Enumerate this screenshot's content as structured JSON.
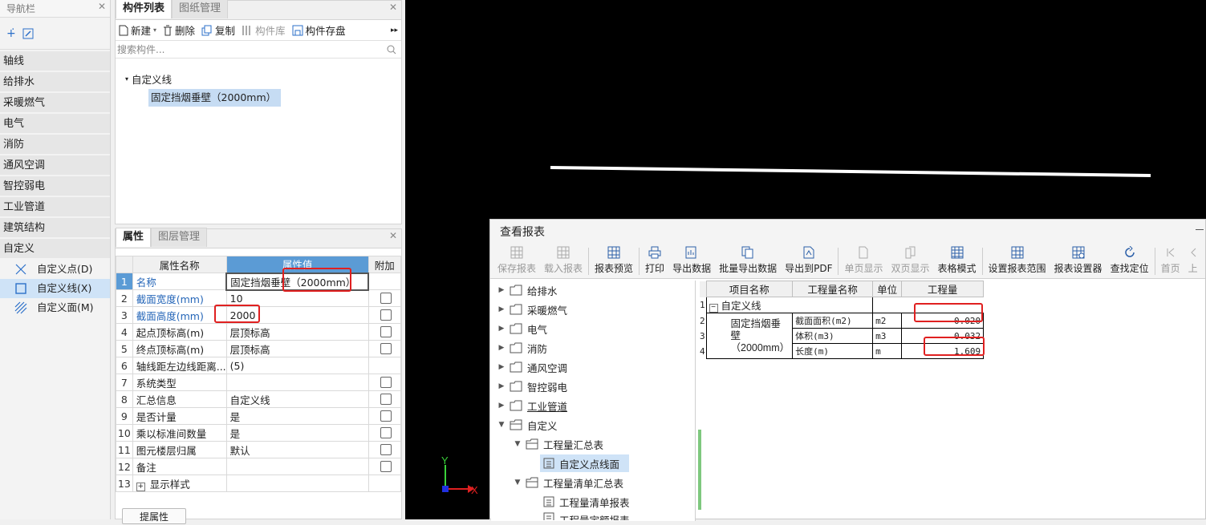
{
  "nav": {
    "title": "导航栏",
    "categories": [
      "轴线",
      "给排水",
      "采暖燃气",
      "电气",
      "消防",
      "通风空调",
      "智控弱电",
      "工业管道",
      "建筑结构",
      "自定义"
    ],
    "sub_items": [
      "自定义点(D)",
      "自定义线(X)",
      "自定义面(M)"
    ]
  },
  "component_panel": {
    "tabs": [
      "构件列表",
      "图纸管理"
    ],
    "toolbar": {
      "new": "新建",
      "delete": "删除",
      "copy": "复制",
      "library": "构件库",
      "save": "构件存盘"
    },
    "search_placeholder": "搜索构件...",
    "tree_root": "自定义线",
    "selected_item": "固定挡烟垂壁（2000mm）"
  },
  "properties_panel": {
    "tabs": [
      "属性",
      "图层管理"
    ],
    "headers": {
      "name": "属性名称",
      "value": "属性值",
      "extra": "附加"
    },
    "rows": [
      {
        "no": "1",
        "name": "名称",
        "value": "固定挡烟垂壁（2000mm）"
      },
      {
        "no": "2",
        "name": "截面宽度(mm)",
        "value": "10"
      },
      {
        "no": "3",
        "name": "截面高度(mm)",
        "value": "2000"
      },
      {
        "no": "4",
        "name": "起点顶标高(m)",
        "value": "层顶标高"
      },
      {
        "no": "5",
        "name": "终点顶标高(m)",
        "value": "层顶标高"
      },
      {
        "no": "6",
        "name": "轴线距左边线距离...",
        "value": "(5)"
      },
      {
        "no": "7",
        "name": "系统类型",
        "value": ""
      },
      {
        "no": "8",
        "name": "汇总信息",
        "value": "自定义线"
      },
      {
        "no": "9",
        "name": "是否计量",
        "value": "是"
      },
      {
        "no": "10",
        "name": "乘以标准间数量",
        "value": "是"
      },
      {
        "no": "11",
        "name": "图元楼层归属",
        "value": "默认"
      },
      {
        "no": "12",
        "name": "备注",
        "value": ""
      },
      {
        "no": "13",
        "name": "显示样式",
        "value": ""
      }
    ],
    "bottom_button": "提属性"
  },
  "cad": {
    "axis_x": "X",
    "axis_y": "Y"
  },
  "report": {
    "title": "查看报表",
    "toolbar": [
      "保存报表",
      "载入报表",
      "报表预览",
      "打印",
      "导出数据",
      "批量导出数据",
      "导出到PDF",
      "单页显示",
      "双页显示",
      "表格模式",
      "设置报表范围",
      "报表设置器",
      "查找定位",
      "首页",
      "上"
    ],
    "tree": [
      "给排水",
      "采暖燃气",
      "电气",
      "消防",
      "通风空调",
      "智控弱电",
      "工业管道",
      "自定义",
      "工程量汇总表",
      "自定义点线面",
      "工程量清单汇总表",
      "工程量清单报表",
      "工程量定额报表"
    ],
    "table": {
      "headers": [
        "项目名称",
        "工程量名称",
        "单位",
        "工程量"
      ],
      "group": "自定义线",
      "item_name": "固定挡烟垂壁（2000mm）",
      "rows": [
        {
          "qty_name": "截面面积(m2)",
          "unit": "m2",
          "qty": "0.020"
        },
        {
          "qty_name": "体积(m3)",
          "unit": "m3",
          "qty": "0.032"
        },
        {
          "qty_name": "长度(m)",
          "unit": "m",
          "qty": "1.609"
        }
      ],
      "row_numbers": [
        "1",
        "2",
        "3",
        "4"
      ]
    }
  },
  "colors": {
    "accent": "#5b9bd5",
    "highlight": "#e02020",
    "selection": "#c6dcf3"
  }
}
